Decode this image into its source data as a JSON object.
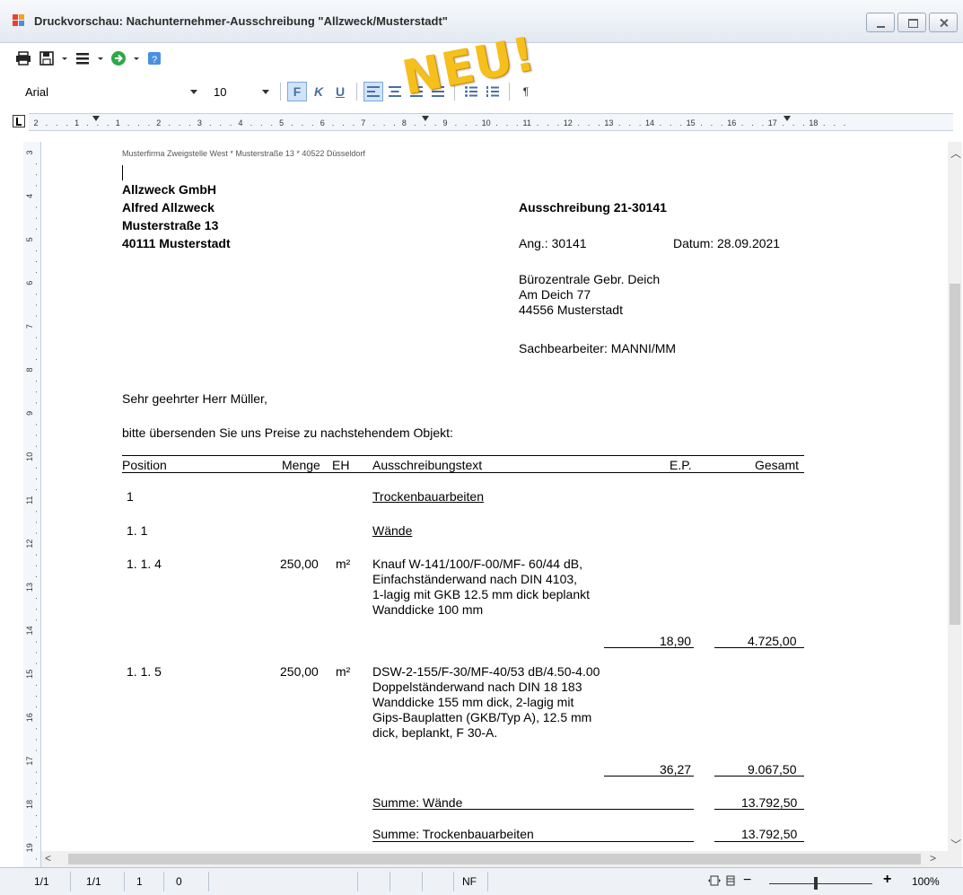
{
  "window": {
    "title": "Druckvorschau: Nachunternehmer-Ausschreibung \"Allzweck/Musterstadt\"",
    "accent_color": "#4a6fa5"
  },
  "toolbar": {
    "font_name": "Arial",
    "font_size": "10",
    "bold_label": "F",
    "italic_label": "K",
    "underline_label": "U",
    "paragraph_label": "¶"
  },
  "badge": {
    "text": "NEU!",
    "color": "#f5bf1c"
  },
  "ruler": {
    "h_labels": [
      "2",
      "1",
      "1",
      "2",
      "3",
      "4",
      "5",
      "6",
      "7",
      "8",
      "9",
      "10",
      "11",
      "12",
      "13",
      "14",
      "15",
      "16",
      "17",
      "18"
    ],
    "v_labels": [
      "3",
      "4",
      "5",
      "6",
      "7",
      "8",
      "9",
      "10",
      "11",
      "12",
      "13",
      "14",
      "15",
      "16",
      "17",
      "18",
      "19"
    ]
  },
  "document": {
    "sender_line": "Musterfirma Zweigstelle West * Musterstraße 13 * 40522 Düsseldorf",
    "recipient": [
      "Allzweck GmbH",
      "Alfred Allzweck",
      "Musterstraße 13",
      "40111 Musterstadt"
    ],
    "doc_title": "Ausschreibung 21-30141",
    "ang": "Ang.:  30141",
    "datum": "Datum: 28.09.2021",
    "office": [
      "Bürozentrale Gebr. Deich",
      "Am Deich 77",
      "44556 Musterstadt"
    ],
    "sachbearbeiter": "Sachbearbeiter:  MANNI/MM",
    "greeting": "Sehr geehrter Herr Müller,",
    "intro": "bitte übersenden Sie uns Preise zu nachstehendem Objekt:",
    "headers": {
      "position": "Position",
      "menge": "Menge",
      "eh": "EH",
      "text": "Ausschreibungstext",
      "ep": "E.P.",
      "gesamt": "Gesamt"
    },
    "pos1": {
      "pos": "1",
      "title": "Trockenbauarbeiten"
    },
    "pos11": {
      "pos": "1. 1",
      "title": "Wände"
    },
    "pos114": {
      "pos": "1. 1.  4",
      "menge": "250,00",
      "eh": "m²",
      "text": [
        "Knauf W-141/100/F-00/MF- 60/44 dB,",
        "Einfachständerwand nach DIN 4103,",
        "1-lagig mit GKB 12.5 mm dick beplankt",
        "Wanddicke 100 mm"
      ],
      "ep": "18,90",
      "gesamt": "4.725,00"
    },
    "pos115": {
      "pos": "1. 1.  5",
      "menge": "250,00",
      "eh": "m²",
      "text": [
        "DSW-2-155/F-30/MF-40/53 dB/4.50-4.00",
        "Doppelständerwand nach DIN 18 183",
        "Wanddicke 155 mm dick, 2-lagig mit",
        "Gips-Bauplatten (GKB/Typ A), 12.5 mm",
        "dick, beplankt, F 30-A."
      ],
      "ep": "36,27",
      "gesamt": "9.067,50"
    },
    "summe_waende": {
      "label": "Summe:  Wände",
      "value": "13.792,50"
    },
    "summe_trocken": {
      "label": "Summe:  Trockenbauarbeiten",
      "value": "13.792,50"
    }
  },
  "status": {
    "page1": "1/1",
    "page2": "1/1",
    "col1": "1",
    "col2": "0",
    "mode": "NF",
    "zoom": "100%",
    "zoom_minus": "−",
    "zoom_plus": "+"
  }
}
